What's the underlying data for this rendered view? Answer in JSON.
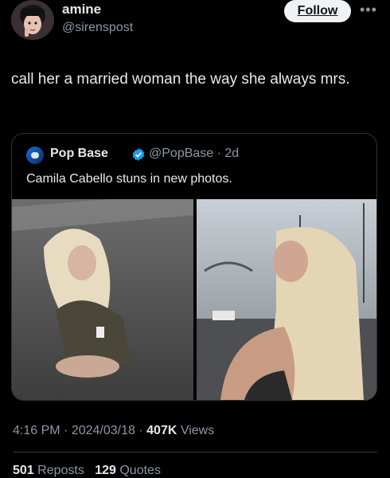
{
  "author": {
    "display_name": "amine",
    "handle": "@sirenspost",
    "follow_label": "Follow",
    "more_icon": "ellipsis-icon"
  },
  "tweet": {
    "text": "call her a married woman the way she always mrs."
  },
  "quote": {
    "display_name": "Pop Base",
    "handle_time": "@PopBase · 2d",
    "verified_icon": "verified-badge-icon",
    "text": "Camila Cabello stuns in new photos."
  },
  "meta": {
    "time": "4:16 PM",
    "date": "2024/03/18",
    "views_count": "407K",
    "views_label": "Views"
  },
  "stats": {
    "reposts_count": "501",
    "reposts_label": "Reposts",
    "quotes_count": "129",
    "quotes_label": "Quotes"
  },
  "colors": {
    "background": "#000000",
    "text_primary": "#e7e9ea",
    "text_secondary": "#8b98a5",
    "verified": "#1d9bf0",
    "border": "#2f3336"
  }
}
